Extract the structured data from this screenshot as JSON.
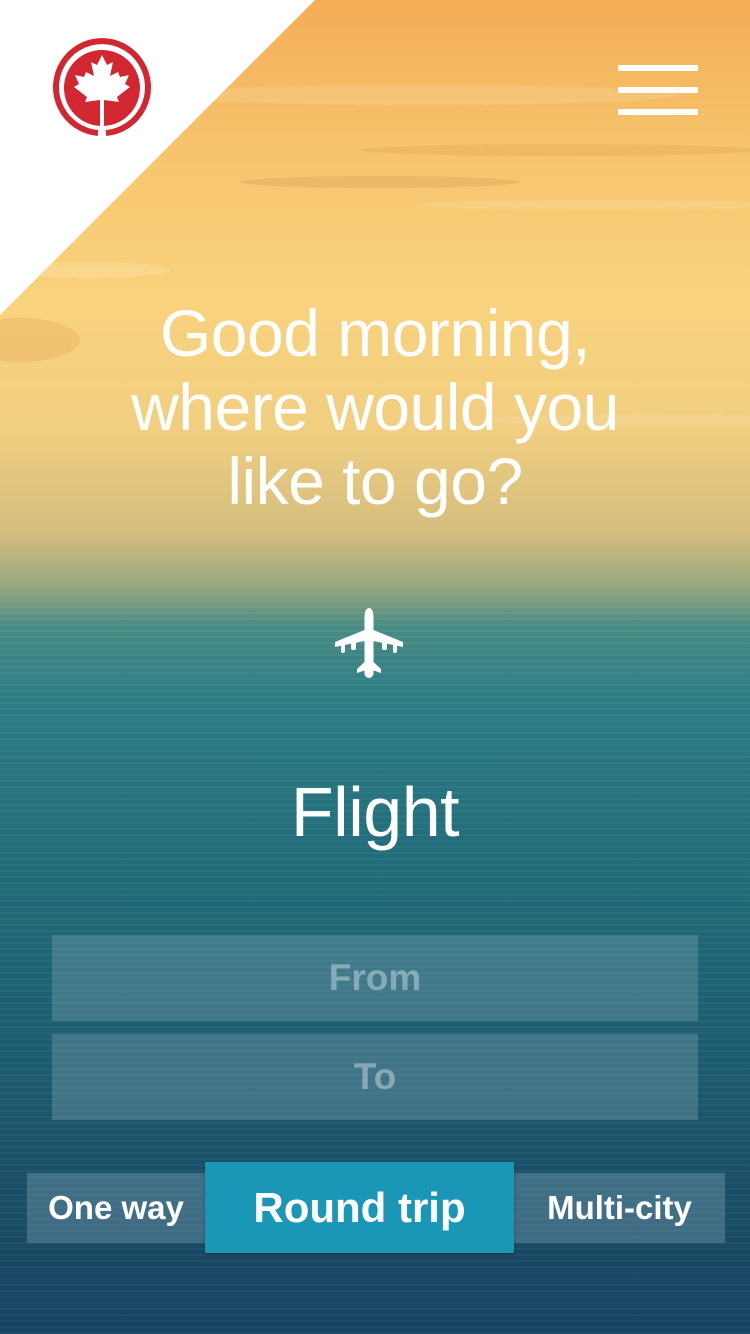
{
  "brand": {
    "logo_icon": "maple-leaf-roundel-icon",
    "red": "#d22630"
  },
  "header": {
    "menu_icon": "hamburger-menu-icon"
  },
  "greeting": {
    "line1": "Good morning,",
    "line2": "where would you",
    "line3": "like to go?"
  },
  "mode": {
    "icon": "airplane-icon",
    "title": "Flight"
  },
  "search": {
    "from_placeholder": "From",
    "to_placeholder": "To"
  },
  "trip_types": {
    "one_way": "One way",
    "round_trip": "Round trip",
    "multi_city": "Multi-city",
    "selected": "Round trip",
    "selected_color": "#1a97b6"
  }
}
